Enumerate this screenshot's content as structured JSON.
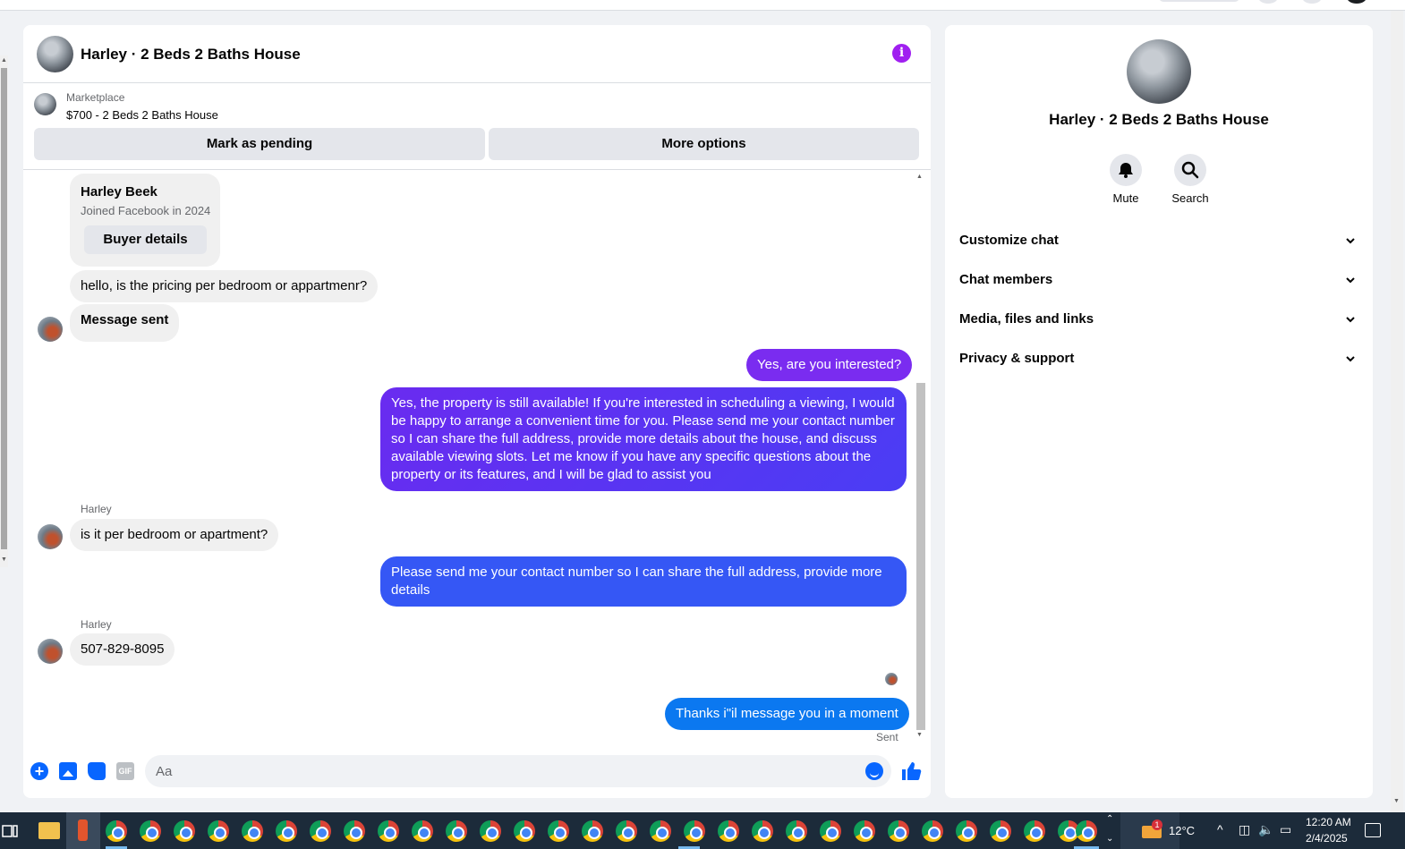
{
  "conversation": {
    "title": "Harley · 2 Beds 2 Baths House"
  },
  "marketplace": {
    "label": "Marketplace",
    "listing": "$700 - 2 Beds 2 Baths House",
    "mark_pending": "Mark as pending",
    "more_options": "More options"
  },
  "buyer_card": {
    "name": "Harley Beek",
    "joined": "Joined Facebook in 2024",
    "button": "Buyer details"
  },
  "messages": [
    {
      "from": "Harley",
      "text": "hello, is the pricing per bedroom or appartmenr?"
    },
    {
      "from": "Harley",
      "text": "Message sent"
    },
    {
      "from": "me",
      "text": "Yes, are you interested?"
    },
    {
      "from": "me",
      "text": "Yes, the property is still available! If you're interested in scheduling a viewing, I would be happy to arrange a convenient time for you. Please send me your contact number so I can share the full address, provide more details about the house, and discuss available viewing slots. Let me know if you have any specific questions about the property or its features, and I will be glad to assist you"
    },
    {
      "from": "Harley",
      "sender_label": "Harley",
      "text": "is it per bedroom or apartment?"
    },
    {
      "from": "me",
      "text": "Please send me your contact number so I can share the full address, provide more details"
    },
    {
      "from": "Harley",
      "sender_label": "Harley",
      "text": "507-829-8095"
    },
    {
      "from": "me",
      "text": "Thanks i\"il message you in a moment"
    }
  ],
  "sent_status": "Sent",
  "composer": {
    "placeholder": "Aa",
    "gif_label": "GIF"
  },
  "info_panel": {
    "title": "Harley · 2 Beds 2 Baths House",
    "actions": [
      {
        "label": "Mute",
        "icon": "bell-icon"
      },
      {
        "label": "Search",
        "icon": "search-icon"
      }
    ],
    "sections": [
      "Customize chat",
      "Chat members",
      "Media, files and links",
      "Privacy & support"
    ]
  },
  "taskbar": {
    "temperature": "12°C",
    "time": "12:20 AM",
    "date": "2/4/2025",
    "weather_badge": "1"
  },
  "colors": {
    "accent_blue": "#0866ff",
    "info_purple": "#a020f0",
    "bubble_purple": "#7a2cf0",
    "bubble_blue": "#3557f5",
    "bubble_cyan": "#0b78f0"
  }
}
